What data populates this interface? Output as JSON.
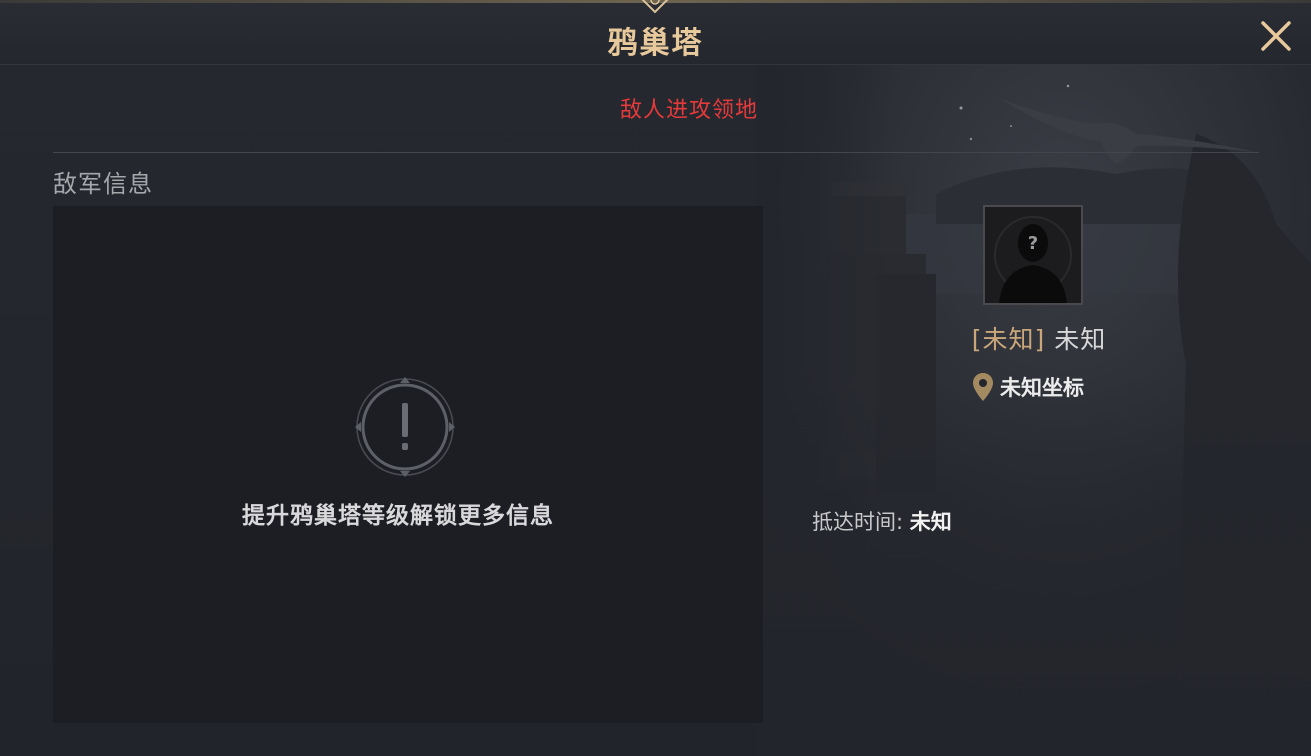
{
  "header": {
    "title": "鸦巢塔",
    "close_icon": "close-icon"
  },
  "banner": {
    "attack_text": "敌人进攻领地",
    "color": "#e53a3a"
  },
  "enemy_info": {
    "section_title": "敌军信息",
    "locked_icon": "exclamation-icon",
    "locked_text": "提升鸦巢塔等级解锁更多信息"
  },
  "enemy": {
    "avatar_icon": "unknown-avatar-icon",
    "alliance_tag": "[未知]",
    "name": "未知",
    "coord_icon": "location-pin-icon",
    "coord_text": "未知坐标",
    "arrival_label": "抵达时间:",
    "arrival_value": "未知"
  },
  "colors": {
    "accent": "#e7c99b",
    "tag": "#c9a77a"
  }
}
